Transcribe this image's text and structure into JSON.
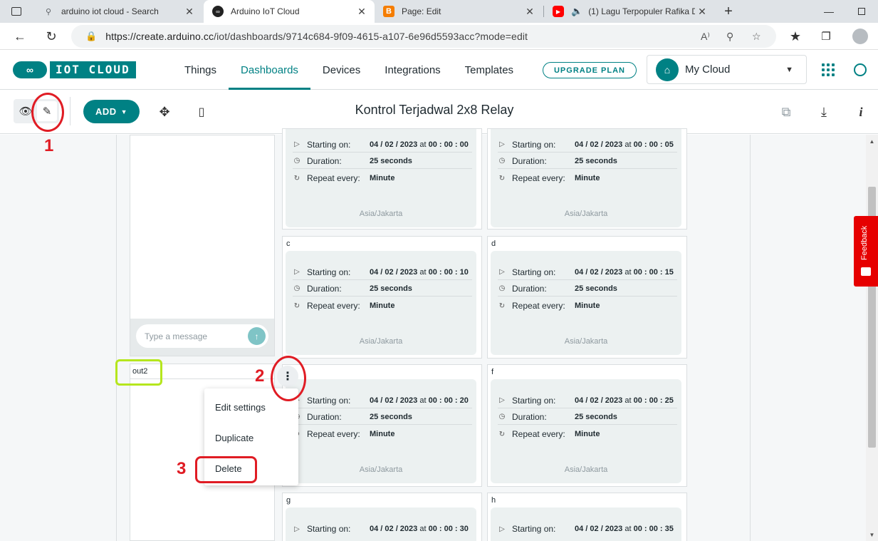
{
  "browser": {
    "tabs": [
      {
        "label": "arduino iot cloud - Search",
        "icon": "search-icon"
      },
      {
        "label": "Arduino IoT Cloud",
        "icon": "arduino-icon"
      },
      {
        "label": "Page: Edit",
        "icon": "blogger-icon"
      },
      {
        "label": "(1) Lagu Terpopuler Rafika D",
        "icon": "youtube-icon"
      }
    ],
    "url_host": "https://create.arduino.cc",
    "url_path": "/iot/dashboards/9714c684-9f09-4615-a107-6e96d5593acc?mode=edit"
  },
  "header": {
    "logo_text": "IOT CLOUD",
    "nav": [
      "Things",
      "Dashboards",
      "Devices",
      "Integrations",
      "Templates"
    ],
    "upgrade_label": "UPGRADE PLAN",
    "cloud_name": "My Cloud"
  },
  "toolbar": {
    "add_label": "ADD",
    "title": "Kontrol Terjadwal 2x8 Relay"
  },
  "messenger": {
    "placeholder": "Type a message"
  },
  "out2": {
    "name": "out2"
  },
  "labels": {
    "starting": "Starting on:",
    "duration": "Duration:",
    "repeat": "Repeat every:",
    "at": "at"
  },
  "schedulers": [
    {
      "name": "",
      "date": "04 / 02 / 2023",
      "time": "00 : 00 : 00",
      "duration": "25 seconds",
      "repeat": "Minute",
      "tz": "Asia/Jakarta"
    },
    {
      "name": "",
      "date": "04 / 02 / 2023",
      "time": "00 : 00 : 05",
      "duration": "25 seconds",
      "repeat": "Minute",
      "tz": "Asia/Jakarta"
    },
    {
      "name": "c",
      "date": "04 / 02 / 2023",
      "time": "00 : 00 : 10",
      "duration": "25 seconds",
      "repeat": "Minute",
      "tz": "Asia/Jakarta"
    },
    {
      "name": "d",
      "date": "04 / 02 / 2023",
      "time": "00 : 00 : 15",
      "duration": "25 seconds",
      "repeat": "Minute",
      "tz": "Asia/Jakarta"
    },
    {
      "name": "",
      "date": "04 / 02 / 2023",
      "time": "00 : 00 : 20",
      "duration": "25 seconds",
      "repeat": "Minute",
      "tz": "Asia/Jakarta"
    },
    {
      "name": "f",
      "date": "04 / 02 / 2023",
      "time": "00 : 00 : 25",
      "duration": "25 seconds",
      "repeat": "Minute",
      "tz": "Asia/Jakarta"
    },
    {
      "name": "g",
      "date": "04 / 02 / 2023",
      "time": "00 : 00 : 30",
      "duration": "",
      "repeat": "",
      "tz": ""
    },
    {
      "name": "h",
      "date": "04 / 02 / 2023",
      "time": "00 : 00 : 35",
      "duration": "",
      "repeat": "",
      "tz": ""
    }
  ],
  "context_menu": {
    "items": [
      "Edit settings",
      "Duplicate",
      "Delete"
    ]
  },
  "feedback_label": "Feedback",
  "annotations": [
    "1",
    "2",
    "3"
  ],
  "colors": {
    "accent": "#008184",
    "annotation_red": "#e01c24",
    "annotation_green": "#b5e61d",
    "feedback_red": "#e60000"
  }
}
